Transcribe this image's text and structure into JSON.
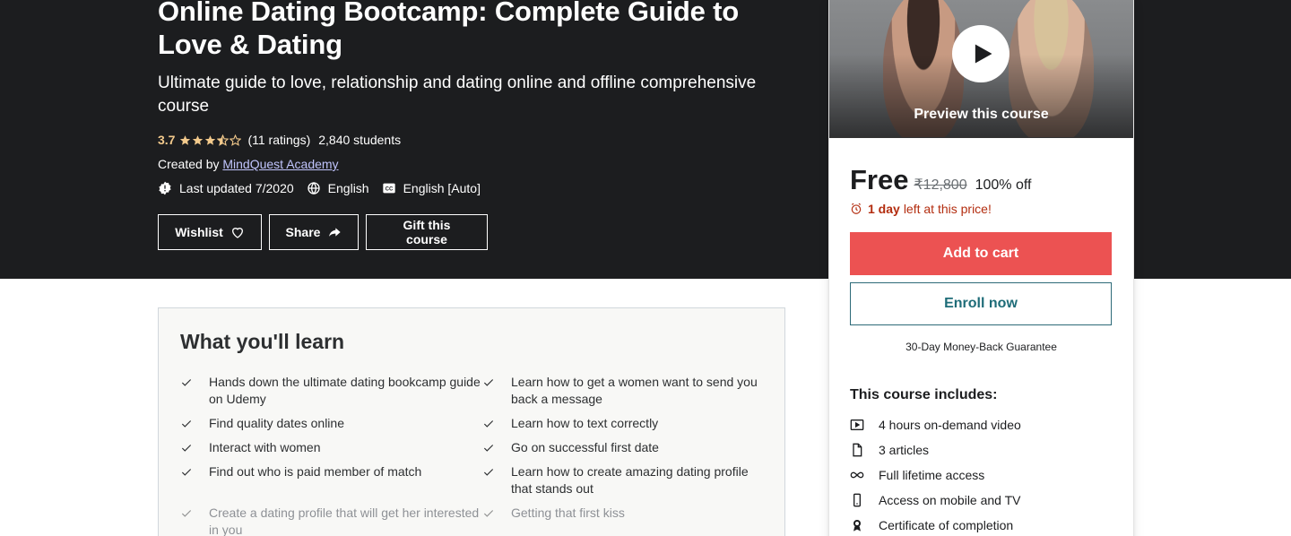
{
  "course": {
    "title": "Online Dating Bootcamp: Complete Guide to Love & Dating",
    "subtitle": "Ultimate guide to love, relationship and dating online and offline comprehensive course",
    "rating": "3.7",
    "rating_value": 3.7,
    "ratings_count": "(11 ratings)",
    "students": "2,840 students",
    "created_by_label": "Created by",
    "author": "MindQuest Academy",
    "last_updated": "Last updated 7/2020",
    "language": "English",
    "captions": "English [Auto]"
  },
  "actions": {
    "wishlist": "Wishlist",
    "share": "Share",
    "gift": "Gift this course"
  },
  "sidebar": {
    "preview_label": "Preview this course",
    "price_now": "Free",
    "price_old": "₹12,800",
    "discount": "100% off",
    "timer_bold": "1 day",
    "timer_rest": "left at this price!",
    "add_to_cart": "Add to cart",
    "enroll_now": "Enroll now",
    "guarantee": "30-Day Money-Back Guarantee",
    "includes_title": "This course includes:",
    "includes": [
      {
        "icon": "video-icon",
        "label": "4 hours on-demand video"
      },
      {
        "icon": "file-icon",
        "label": "3 articles"
      },
      {
        "icon": "infinity-icon",
        "label": "Full lifetime access"
      },
      {
        "icon": "mobile-icon",
        "label": "Access on mobile and TV"
      },
      {
        "icon": "certificate-icon",
        "label": "Certificate of completion"
      }
    ]
  },
  "learn": {
    "title": "What you'll learn",
    "items": [
      "Hands down the ultimate dating bookcamp guide on Udemy",
      "Learn how to get a women want to send you back a message",
      "Find quality dates online",
      "Learn how to text correctly",
      "Interact with women",
      "Go on successful first date",
      "Find out who is paid member of match",
      "Learn how to create amazing dating profile that stands out",
      "Create a dating profile that will get her interested in you",
      "Getting that first kiss"
    ]
  },
  "colors": {
    "hero_bg": "#1c1d1f",
    "rating": "#f3ca8c",
    "cart": "#ec5252",
    "timer": "#b32d0f",
    "enroll": "#1e6c78"
  }
}
